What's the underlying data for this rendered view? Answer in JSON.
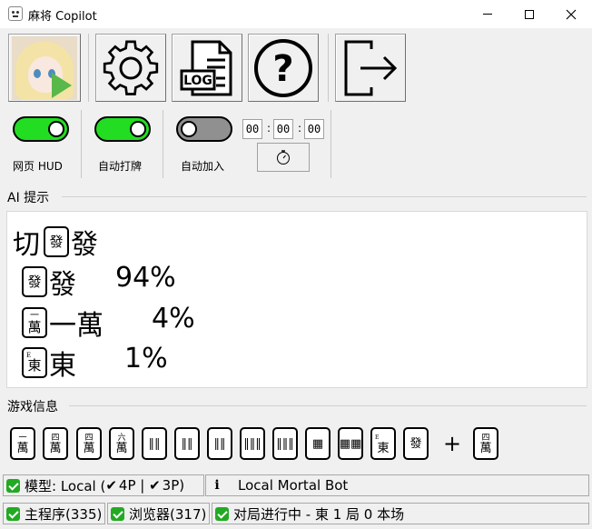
{
  "window": {
    "title": "麻将 Copilot",
    "icon": "mahjong-face-icon",
    "minimize_icon": "minimize-icon",
    "maximize_icon": "maximize-icon",
    "close_icon": "close-icon"
  },
  "toolbar": {
    "avatar": "avatar-play-icon",
    "settings": "gear-icon",
    "log": "log-document-icon",
    "log_label": "LOG",
    "help": "question-icon",
    "help_glyph": "?",
    "exit": "exit-icon"
  },
  "toggles": [
    {
      "label": "网页 HUD",
      "on": true
    },
    {
      "label": "自动打牌",
      "on": true
    },
    {
      "label": "自动加入",
      "on": false
    }
  ],
  "timer": {
    "hours": "00",
    "minutes": "00",
    "seconds": "00",
    "separator": ":",
    "button_icon": "stopwatch-icon"
  },
  "ai": {
    "heading": "AI 提示",
    "action": {
      "verb": "切",
      "tile_face": "發",
      "tile_name": "發"
    },
    "options": [
      {
        "tile_face": "發",
        "tile_top": "",
        "name": "發",
        "prob": "94%"
      },
      {
        "tile_face": "萬",
        "tile_top": "一",
        "name": "一萬",
        "prob": "4%"
      },
      {
        "tile_face": "東",
        "tile_top": "E",
        "name": "東",
        "prob": "1%"
      }
    ]
  },
  "game": {
    "heading": "游戏信息",
    "hand": [
      {
        "top": "一",
        "face": "萬"
      },
      {
        "top": "四",
        "face": "萬"
      },
      {
        "top": "四",
        "face": "萬"
      },
      {
        "top": "六",
        "face": "萬"
      },
      {
        "top": "",
        "face": "‖‖"
      },
      {
        "top": "",
        "face": "‖‖"
      },
      {
        "top": "",
        "face": "‖‖"
      },
      {
        "top": "",
        "face": "‖‖‖"
      },
      {
        "top": "",
        "face": "‖‖‖"
      },
      {
        "top": "",
        "face": "▦"
      },
      {
        "top": "",
        "face": "▦▦"
      },
      {
        "top": "E",
        "face": "東"
      },
      {
        "top": "",
        "face": "發"
      }
    ],
    "plus": "+",
    "draw": {
      "top": "四",
      "face": "萬"
    }
  },
  "status": {
    "model": {
      "prefix": "模型: Local (",
      "four": "4P",
      "sep": " | ",
      "three": "3P)"
    },
    "bot": "Local Mortal Bot",
    "main": "主程序(335)",
    "browser": "浏览器(317)",
    "game_state": "对局进行中 - 東 1 局 0 本场",
    "tick": "✔",
    "info": "i"
  },
  "colors": {
    "toggle_on": "#22dd22",
    "toggle_off": "#909090",
    "status_ok": "#22aa22"
  }
}
